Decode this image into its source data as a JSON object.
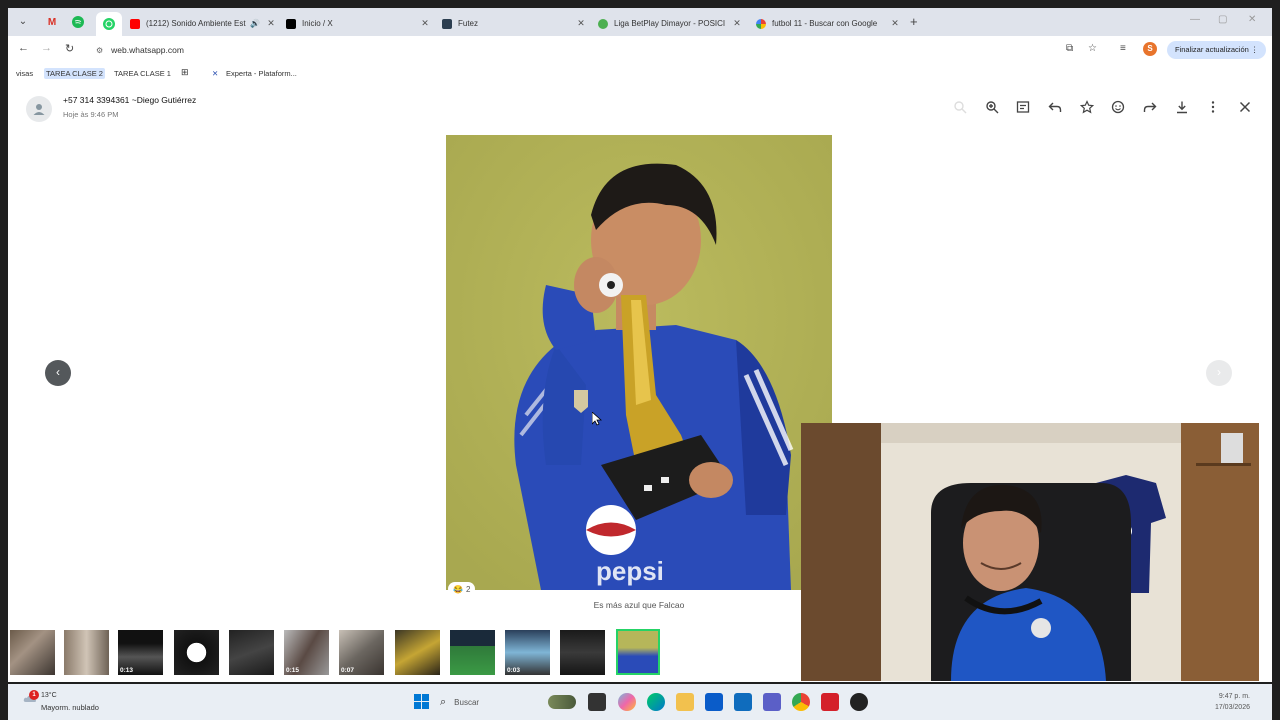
{
  "browser": {
    "tabs": [
      {
        "title": "(1212) Sonido Ambiente Est",
        "favicon": "youtube-icon",
        "audio": true
      },
      {
        "title": "Inicio / X",
        "favicon": "x-icon"
      },
      {
        "title": "Futez",
        "favicon": "f-icon"
      },
      {
        "title": "Liga BetPlay Dimayor - POSICI",
        "favicon": "globe-icon"
      },
      {
        "title": "futbol 11 - Buscar con Google",
        "favicon": "google-icon"
      }
    ],
    "url": "web.whatsapp.com",
    "profile_initial": "S",
    "update_button": "Finalizar actualización",
    "bookmarks": [
      "visas",
      "TAREA CLASE 2",
      "TAREA CLASE 1",
      "Experta - Plataform..."
    ]
  },
  "viewer": {
    "contact_name": "+57 314 3394361 ~Diego Gutiérrez",
    "timestamp": "Hoje às 9:46 PM",
    "reaction_emoji": "😂",
    "reaction_count": "2",
    "caption": "Es más azul que Falcao",
    "prev_label": "‹",
    "next_label": "›",
    "thumbnails": [
      {
        "duration": ""
      },
      {
        "duration": ""
      },
      {
        "duration": "0:13"
      },
      {
        "duration": ""
      },
      {
        "duration": ""
      },
      {
        "duration": "0:15"
      },
      {
        "duration": "0:07"
      },
      {
        "duration": ""
      },
      {
        "duration": ""
      },
      {
        "duration": "0:03"
      },
      {
        "duration": ""
      },
      {
        "duration": ""
      }
    ]
  },
  "taskbar": {
    "weather_badge": "1",
    "temperature": "13°C",
    "weather_desc": "Mayorm. nublado",
    "search_placeholder": "Buscar",
    "time": "9:47 p. m.",
    "date": "17/03/2026"
  },
  "colors": {
    "accent": "#25d366",
    "chrome_tab_bg": "#dfe3eb",
    "update_btn": "#d3e3fd"
  }
}
